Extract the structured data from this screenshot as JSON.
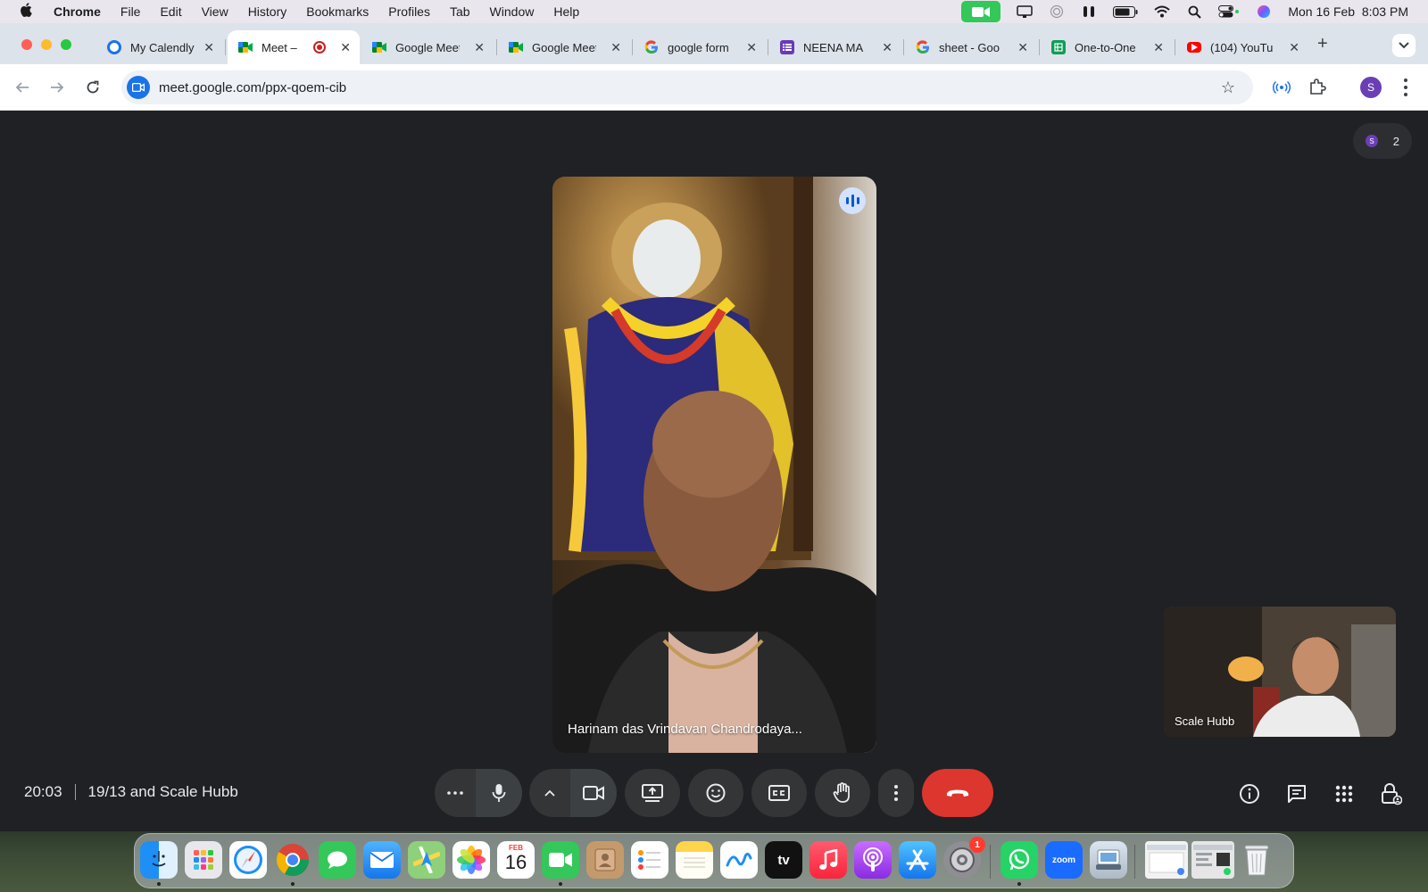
{
  "menubar": {
    "app_name": "Chrome",
    "menus": [
      "File",
      "Edit",
      "View",
      "History",
      "Bookmarks",
      "Profiles",
      "Tab",
      "Window",
      "Help"
    ],
    "datetime": "Mon 16 Feb  8:03 PM"
  },
  "tabs": [
    {
      "title": "My Calendly",
      "icon": "calendly-icon",
      "color": "#1a73e8"
    },
    {
      "title": "Meet – ",
      "icon": "meet-icon",
      "color": "#00832d",
      "active": true,
      "recording": true
    },
    {
      "title": "Google Meet",
      "icon": "meet-icon",
      "color": "#00832d"
    },
    {
      "title": "Google Meet",
      "icon": "meet-icon",
      "color": "#00832d"
    },
    {
      "title": "google form",
      "icon": "google-icon",
      "color": "#4285f4"
    },
    {
      "title": "NEENA MA",
      "icon": "forms-icon",
      "color": "#673ab7"
    },
    {
      "title": "sheet - Goo",
      "icon": "google-icon",
      "color": "#4285f4"
    },
    {
      "title": "One-to-One",
      "icon": "sheets-icon",
      "color": "#0f9d58"
    },
    {
      "title": "(104) YouTu",
      "icon": "youtube-icon",
      "color": "#ff0000"
    }
  ],
  "address_bar": {
    "url": "meet.google.com/ppx-qoem-cib"
  },
  "profile_initial": "S",
  "meet": {
    "main_participant": "Harinam das Vrindavan Chandrodaya...",
    "self_participant": "Scale Hubb",
    "participant_count": "2",
    "participant_avatar_initial": "S",
    "time": "20:03",
    "meeting_name": "19/13 and Scale Hubb"
  },
  "dock": {
    "calendar_month": "FEB",
    "calendar_day": "16",
    "settings_badge": "1",
    "tv_label": "tv",
    "zoom_label": "zoom"
  },
  "colors": {
    "meet_bg": "#202124",
    "control_bg": "#333537",
    "end_call": "#dc362e",
    "accent": "#1a73e8"
  }
}
